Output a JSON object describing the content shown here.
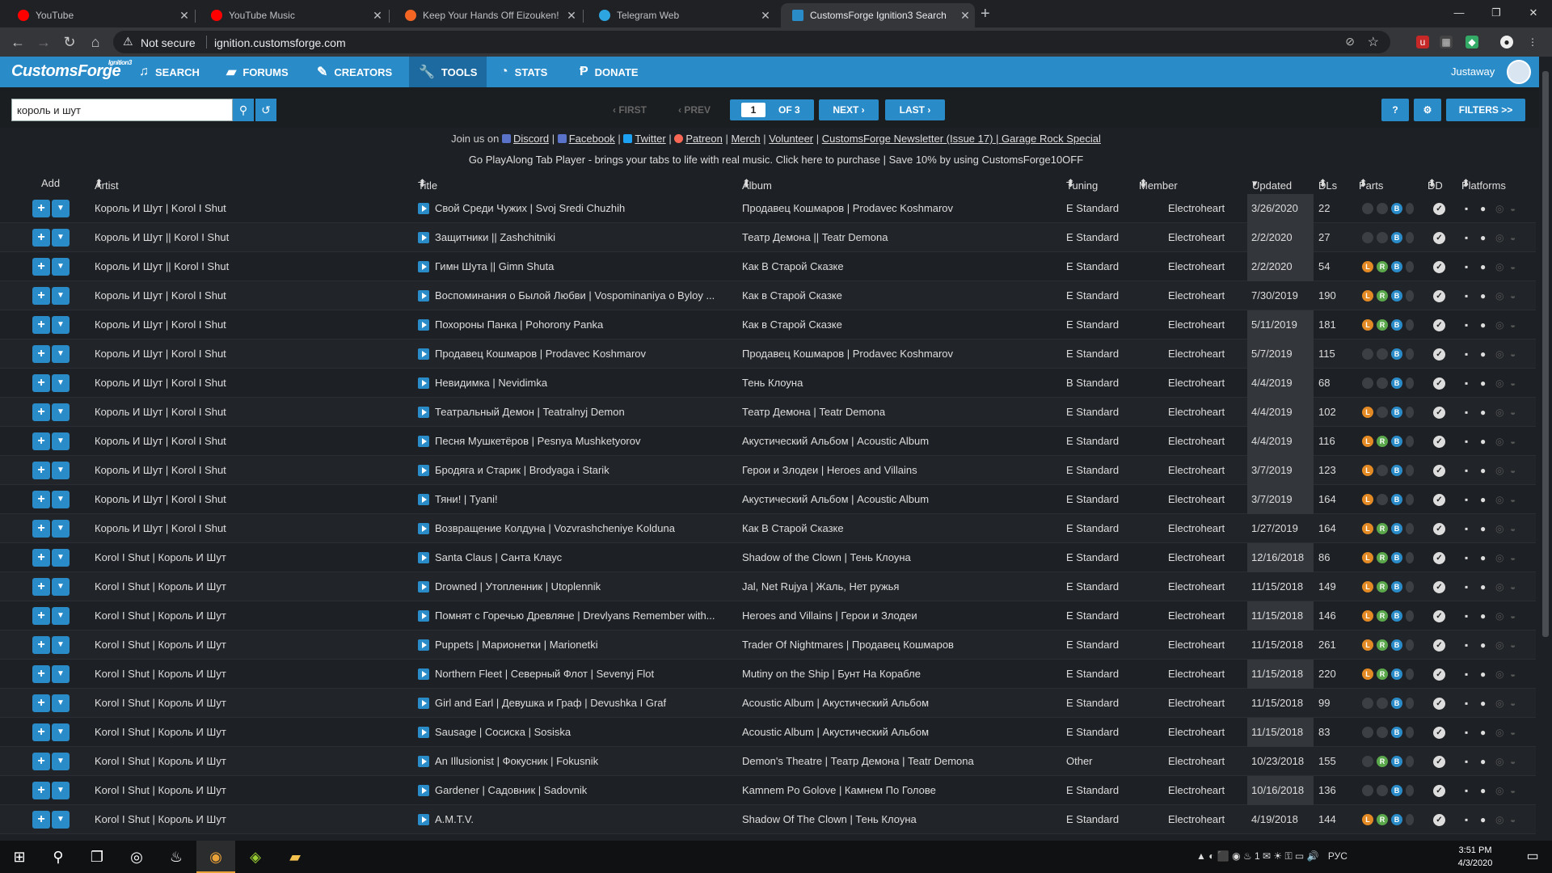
{
  "browser": {
    "tabs": [
      {
        "title": "YouTube",
        "favicon_color": "#ff0000",
        "active": false
      },
      {
        "title": "YouTube Music",
        "favicon_color": "#ff0000",
        "active": false
      },
      {
        "title": "Keep Your Hands Off Eizouken! E",
        "favicon_color": "#f26522",
        "active": false
      },
      {
        "title": "Telegram Web",
        "favicon_color": "#2ca5e0",
        "active": false
      },
      {
        "title": "CustomsForge Ignition3 Search",
        "favicon_color": "#2a8bc9",
        "active": true
      }
    ],
    "security_label": "Not secure",
    "url": "ignition.customsforge.com"
  },
  "site": {
    "logo": "CustomsForge",
    "logo_sub": "Ignition3",
    "nav": [
      {
        "label": "SEARCH",
        "icon": "music-note-icon"
      },
      {
        "label": "FORUMS",
        "icon": "folder-icon"
      },
      {
        "label": "CREATORS",
        "icon": "edit-icon"
      },
      {
        "label": "TOOLS",
        "icon": "wrench-icon"
      },
      {
        "label": "STATS",
        "icon": "dashboard-icon"
      },
      {
        "label": "DONATE",
        "icon": "paypal-icon"
      }
    ],
    "username": "Justaway"
  },
  "toolbar": {
    "search_value": "король и шут",
    "first": "‹ FIRST",
    "prev": "‹ PREV",
    "page": "1",
    "of": "OF 3",
    "next": "NEXT ›",
    "last": "LAST ›",
    "help": "?",
    "filters": "FILTERS >>"
  },
  "banner": {
    "join": "Join us on",
    "links": [
      "Discord",
      "Facebook",
      "Twitter",
      "Patreon",
      "Merch",
      "Volunteer",
      "CustomsForge Newsletter (Issue 17) | Garage Rock Special"
    ],
    "line2": "Go PlayAlong Tab Player - brings your tabs to life with real music. Click here to purchase | Save 10% by using CustomsForge10OFF"
  },
  "table": {
    "headers": {
      "add": "Add",
      "artist": "Artist",
      "title": "Title",
      "album": "Album",
      "tuning": "Tuning",
      "member": "Member",
      "updated": "Updated",
      "dls": "DLs",
      "parts": "Parts",
      "dd": "DD",
      "platforms": "Platforms"
    },
    "rows": [
      {
        "artist": "Король И Шут | Korol I Shut",
        "title": "Свой Среди Чужих | Svoj Sredi Chuzhih",
        "album": "Продавец Кошмаров | Prodavec Koshmarov",
        "tuning": "E Standard",
        "member": "Electroheart",
        "updated": "3/26/2020",
        "dls": "22",
        "hl": true,
        "parts": [
          0,
          0,
          1
        ]
      },
      {
        "artist": "Король И Шут || Korol I Shut",
        "title": "Защитники || Zashchitniki",
        "album": "Театр Демона || Teatr Demona",
        "tuning": "E Standard",
        "member": "Electroheart",
        "updated": "2/2/2020",
        "dls": "27",
        "hl": true,
        "parts": [
          0,
          0,
          1
        ]
      },
      {
        "artist": "Король И Шут || Korol I Shut",
        "title": "Гимн Шута || Gimn Shuta",
        "album": "Как В Старой Сказке",
        "tuning": "E Standard",
        "member": "Electroheart",
        "updated": "2/2/2020",
        "dls": "54",
        "hl": true,
        "parts": [
          1,
          1,
          1
        ]
      },
      {
        "artist": "Король И Шут | Korol I Shut",
        "title": "Воспоминания о Былой Любви | Vospominaniya o Byloy ...",
        "album": "Как в Старой Сказке",
        "tuning": "E Standard",
        "member": "Electroheart",
        "updated": "7/30/2019",
        "dls": "190",
        "hl": false,
        "parts": [
          1,
          1,
          1
        ]
      },
      {
        "artist": "Король И Шут | Korol I Shut",
        "title": "Похороны Панка | Pohorony Panka",
        "album": "Как в Старой Сказке",
        "tuning": "E Standard",
        "member": "Electroheart",
        "updated": "5/11/2019",
        "dls": "181",
        "hl": true,
        "parts": [
          1,
          1,
          1
        ]
      },
      {
        "artist": "Король И Шут | Korol I Shut",
        "title": "Продавец Кошмаров | Prodavec Koshmarov",
        "album": "Продавец Кошмаров | Prodavec Koshmarov",
        "tuning": "E Standard",
        "member": "Electroheart",
        "updated": "5/7/2019",
        "dls": "115",
        "hl": true,
        "parts": [
          0,
          0,
          1
        ]
      },
      {
        "artist": "Король И Шут | Korol I Shut",
        "title": "Невидимка | Nevidimka",
        "album": "Тень Клоуна",
        "tuning": "B Standard",
        "member": "Electroheart",
        "updated": "4/4/2019",
        "dls": "68",
        "hl": true,
        "parts": [
          0,
          0,
          1
        ]
      },
      {
        "artist": "Король И Шут | Korol I Shut",
        "title": "Театральный Демон | Teatralnyj Demon",
        "album": "Театр Демона | Teatr Demona",
        "tuning": "E Standard",
        "member": "Electroheart",
        "updated": "4/4/2019",
        "dls": "102",
        "hl": true,
        "parts": [
          1,
          0,
          1
        ]
      },
      {
        "artist": "Король И Шут | Korol I Shut",
        "title": "Песня Мушкетёров | Pesnya Mushketyorov",
        "album": "Акустический Альбом | Acoustic Album",
        "tuning": "E Standard",
        "member": "Electroheart",
        "updated": "4/4/2019",
        "dls": "116",
        "hl": true,
        "parts": [
          1,
          1,
          1
        ]
      },
      {
        "artist": "Король И Шут | Korol I Shut",
        "title": "Бродяга и Старик | Brodyaga i Starik",
        "album": "Герои и Злодеи | Heroes and Villains",
        "tuning": "E Standard",
        "member": "Electroheart",
        "updated": "3/7/2019",
        "dls": "123",
        "hl": true,
        "parts": [
          1,
          0,
          1
        ]
      },
      {
        "artist": "Король И Шут | Korol I Shut",
        "title": "Тяни! | Tyani!",
        "album": "Акустический Альбом | Acoustic Album",
        "tuning": "E Standard",
        "member": "Electroheart",
        "updated": "3/7/2019",
        "dls": "164",
        "hl": true,
        "parts": [
          1,
          0,
          1
        ]
      },
      {
        "artist": "Король И Шут | Korol I Shut",
        "title": "Возвращение Колдуна | Vozvrashcheniye Kolduna",
        "album": "Как В Старой Сказке",
        "tuning": "E Standard",
        "member": "Electroheart",
        "updated": "1/27/2019",
        "dls": "164",
        "hl": false,
        "parts": [
          1,
          1,
          1
        ]
      },
      {
        "artist": "Korol I Shut | Король И Шут",
        "title": "Santa Claus | Санта Клаус",
        "album": "Shadow of the Clown | Тень Клоуна",
        "tuning": "E Standard",
        "member": "Electroheart",
        "updated": "12/16/2018",
        "dls": "86",
        "hl": true,
        "parts": [
          1,
          1,
          1
        ]
      },
      {
        "artist": "Korol I Shut | Король И Шут",
        "title": "Drowned | Утопленник | Utoplennik",
        "album": "Jal, Net Rujya | Жаль, Нет ружья",
        "tuning": "E Standard",
        "member": "Electroheart",
        "updated": "11/15/2018",
        "dls": "149",
        "hl": false,
        "parts": [
          1,
          1,
          1
        ]
      },
      {
        "artist": "Korol I Shut | Король И Шут",
        "title": "Помнят с Горечью Древляне | Drevlyans Remember with...",
        "album": "Heroes and Villains | Герои и Злодеи",
        "tuning": "E Standard",
        "member": "Electroheart",
        "updated": "11/15/2018",
        "dls": "146",
        "hl": true,
        "parts": [
          1,
          1,
          1
        ]
      },
      {
        "artist": "Korol I Shut | Король И Шут",
        "title": "Puppets | Марионетки | Marionetki",
        "album": "Trader Of Nightmares | Продавец Кошмаров",
        "tuning": "E Standard",
        "member": "Electroheart",
        "updated": "11/15/2018",
        "dls": "261",
        "hl": false,
        "parts": [
          1,
          1,
          1
        ]
      },
      {
        "artist": "Korol I Shut | Король И Шут",
        "title": "Northern Fleet | Северный Флот | Sevenyj Flot",
        "album": "Mutiny on the Ship | Бунт На Корабле",
        "tuning": "E Standard",
        "member": "Electroheart",
        "updated": "11/15/2018",
        "dls": "220",
        "hl": true,
        "parts": [
          1,
          1,
          1
        ]
      },
      {
        "artist": "Korol I Shut | Король И Шут",
        "title": "Girl and Earl | Девушка и Граф | Devushka I Graf",
        "album": "Acoustic Album | Акустический Альбом",
        "tuning": "E Standard",
        "member": "Electroheart",
        "updated": "11/15/2018",
        "dls": "99",
        "hl": false,
        "parts": [
          0,
          0,
          1
        ]
      },
      {
        "artist": "Korol I Shut | Король И Шут",
        "title": "Sausage | Сосиска | Sosiska",
        "album": "Acoustic Album | Акустический Альбом",
        "tuning": "E Standard",
        "member": "Electroheart",
        "updated": "11/15/2018",
        "dls": "83",
        "hl": true,
        "parts": [
          0,
          0,
          1
        ]
      },
      {
        "artist": "Korol I Shut | Король И Шут",
        "title": "An Illusionist | Фокусник | Fokusnik",
        "album": "Demon's Theatre | Театр Демона | Teatr Demona",
        "tuning": "Other",
        "member": "Electroheart",
        "updated": "10/23/2018",
        "dls": "155",
        "hl": false,
        "parts": [
          0,
          1,
          1
        ]
      },
      {
        "artist": "Korol I Shut | Король И Шут",
        "title": "Gardener | Садовник | Sadovnik",
        "album": "Kamnem Po Golove | Камнем По Голове",
        "tuning": "E Standard",
        "member": "Electroheart",
        "updated": "10/16/2018",
        "dls": "136",
        "hl": true,
        "parts": [
          0,
          0,
          1
        ]
      },
      {
        "artist": "Korol I Shut | Король И Шут",
        "title": "A.M.T.V.",
        "album": "Shadow Of The Clown | Тень Клоуна",
        "tuning": "E Standard",
        "member": "Electroheart",
        "updated": "4/19/2018",
        "dls": "144",
        "hl": false,
        "parts": [
          1,
          1,
          1
        ]
      }
    ]
  },
  "taskbar": {
    "lang": "РУС",
    "time": "3:51 PM",
    "date": "4/3/2020"
  }
}
